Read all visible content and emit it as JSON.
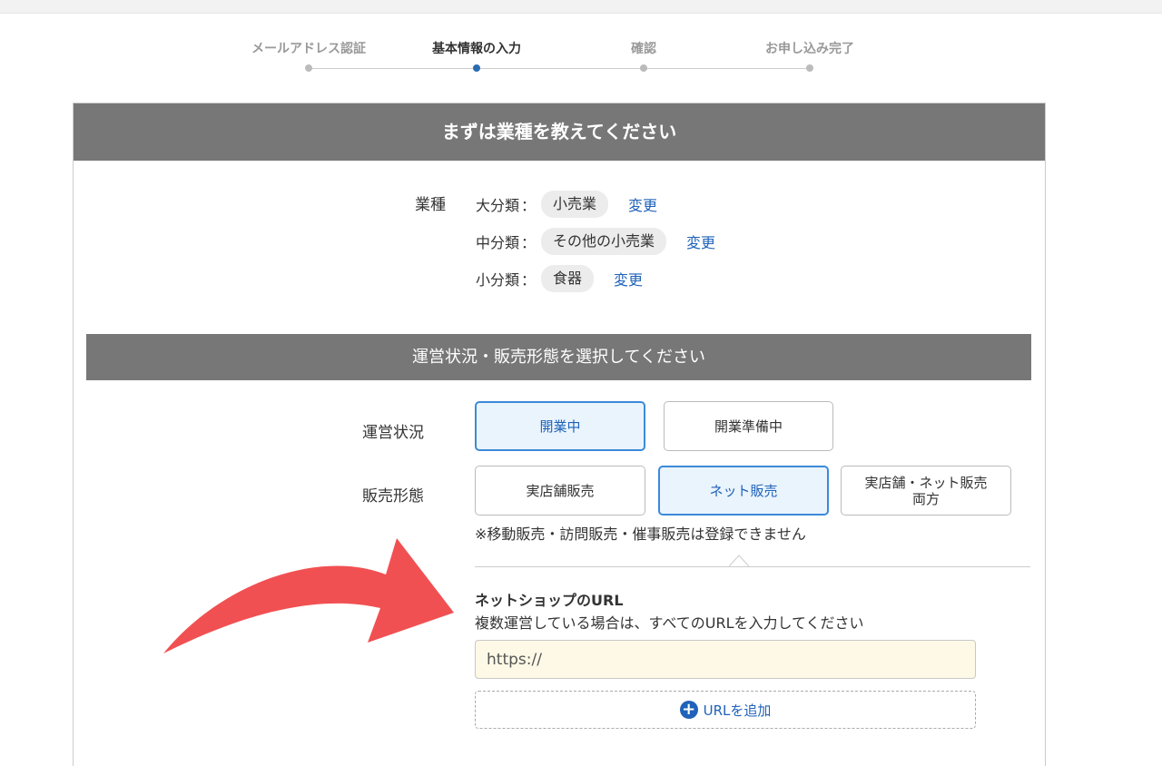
{
  "steps": [
    {
      "label": "メールアドレス認証",
      "active": false
    },
    {
      "label": "基本情報の入力",
      "active": true
    },
    {
      "label": "確認",
      "active": false
    },
    {
      "label": "お申し込み完了",
      "active": false
    }
  ],
  "card": {
    "header": "まずは業種を教えてください"
  },
  "industry": {
    "label": "業種",
    "rows": [
      {
        "key": "大分類",
        "colon": "：",
        "value": "小売業",
        "change": "変更"
      },
      {
        "key": "中分類",
        "colon": "：",
        "value": "その他の小売業",
        "change": "変更"
      },
      {
        "key": "小分類",
        "colon": "：",
        "value": "食器",
        "change": "変更"
      }
    ]
  },
  "operation_section": {
    "header": "運営状況・販売形態を選択してください",
    "status_label": "運営状況",
    "status_options": [
      "開業中",
      "開業準備中"
    ],
    "status_selected": "開業中",
    "sales_label": "販売形態",
    "sales_options": [
      "実店舗販売",
      "ネット販売",
      "実店舗・ネット販売",
      "両方"
    ],
    "sales_selected": "ネット販売",
    "note": "※移動販売・訪問販売・催事販売は登録できません"
  },
  "url_section": {
    "title": "ネットショップのURL",
    "description": "複数運営している場合は、すべてのURLを入力してください",
    "placeholder": "https://",
    "add_label": "URLを追加"
  },
  "colors": {
    "accent": "#1f62b8",
    "selected_border": "#3b8ad9",
    "header_bg": "#777777",
    "arrow": "#f15052",
    "input_bg": "#fdf9e6"
  }
}
